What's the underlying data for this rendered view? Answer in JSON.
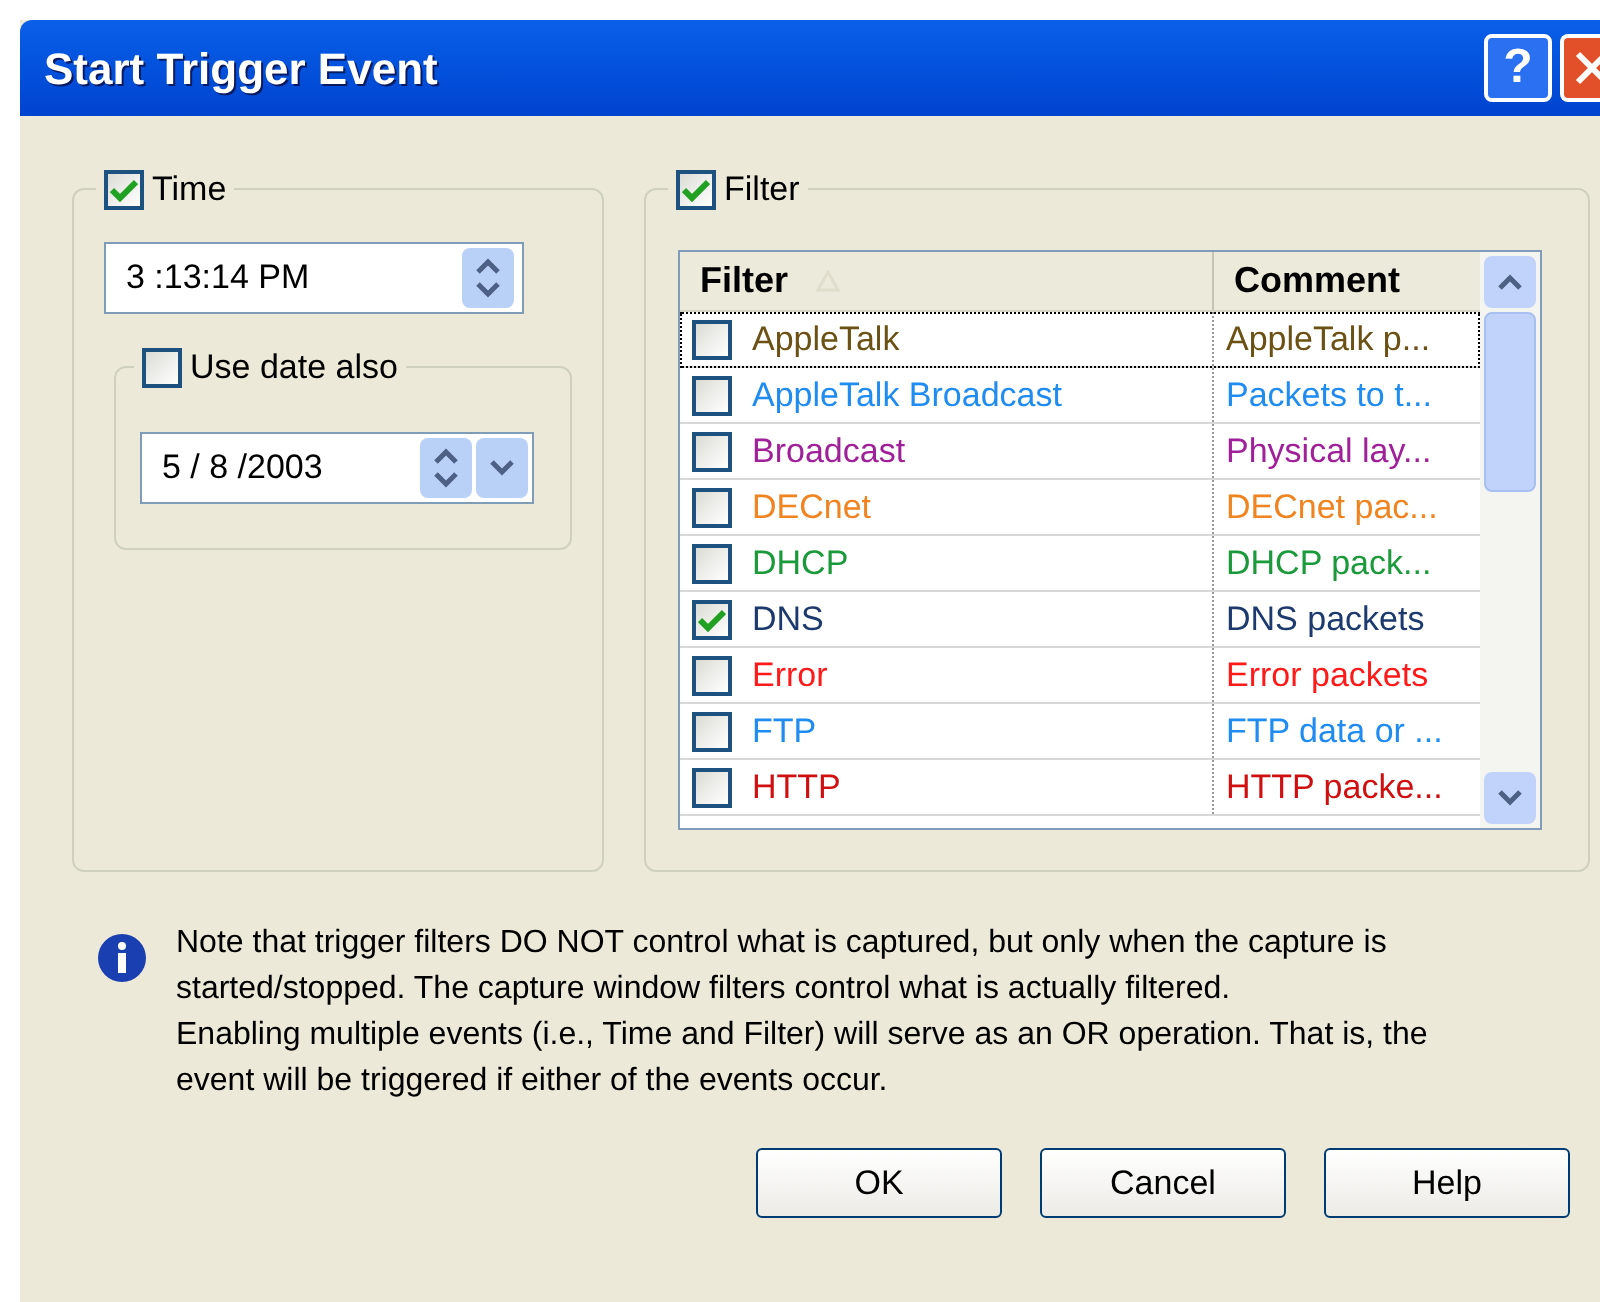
{
  "window": {
    "title": "Start Trigger Event",
    "help_button": "?"
  },
  "time_group": {
    "label": "Time",
    "checked": true,
    "time_value": "3 :13:14 PM",
    "date_group": {
      "label": "Use date also",
      "checked": false,
      "date_value": "5 / 8 /2003"
    }
  },
  "filter_group": {
    "label": "Filter",
    "checked": true,
    "columns": [
      "Filter",
      "Comment"
    ],
    "rows": [
      {
        "name": "AppleTalk",
        "comment": "AppleTalk p...",
        "color": "#6b5214",
        "checked": false,
        "selected": true
      },
      {
        "name": "AppleTalk Broadcast",
        "comment": "Packets to t...",
        "color": "#1e8cf0",
        "checked": false,
        "selected": false
      },
      {
        "name": "Broadcast",
        "comment": "Physical lay...",
        "color": "#a0209a",
        "checked": false,
        "selected": false
      },
      {
        "name": "DECnet",
        "comment": "DECnet pac...",
        "color": "#f08420",
        "checked": false,
        "selected": false
      },
      {
        "name": "DHCP",
        "comment": "DHCP pack...",
        "color": "#1a9a3a",
        "checked": false,
        "selected": false
      },
      {
        "name": "DNS",
        "comment": "DNS packets",
        "color": "#1c3a6e",
        "checked": true,
        "selected": false
      },
      {
        "name": "Error",
        "comment": "Error packets",
        "color": "#ff1a1a",
        "checked": false,
        "selected": false
      },
      {
        "name": "FTP",
        "comment": "FTP data or ...",
        "color": "#1e8cf0",
        "checked": false,
        "selected": false
      },
      {
        "name": "HTTP",
        "comment": "HTTP packe...",
        "color": "#d01010",
        "checked": false,
        "selected": false
      }
    ]
  },
  "note": [
    "Note that trigger filters DO NOT control what is captured, but only when the capture is started/stopped. The capture window filters control what is actually filtered.",
    "Enabling multiple events (i.e., Time and Filter) will serve as an OR operation. That is, the event will be triggered if either of the events occur."
  ],
  "buttons": [
    "OK",
    "Cancel",
    "Help"
  ]
}
